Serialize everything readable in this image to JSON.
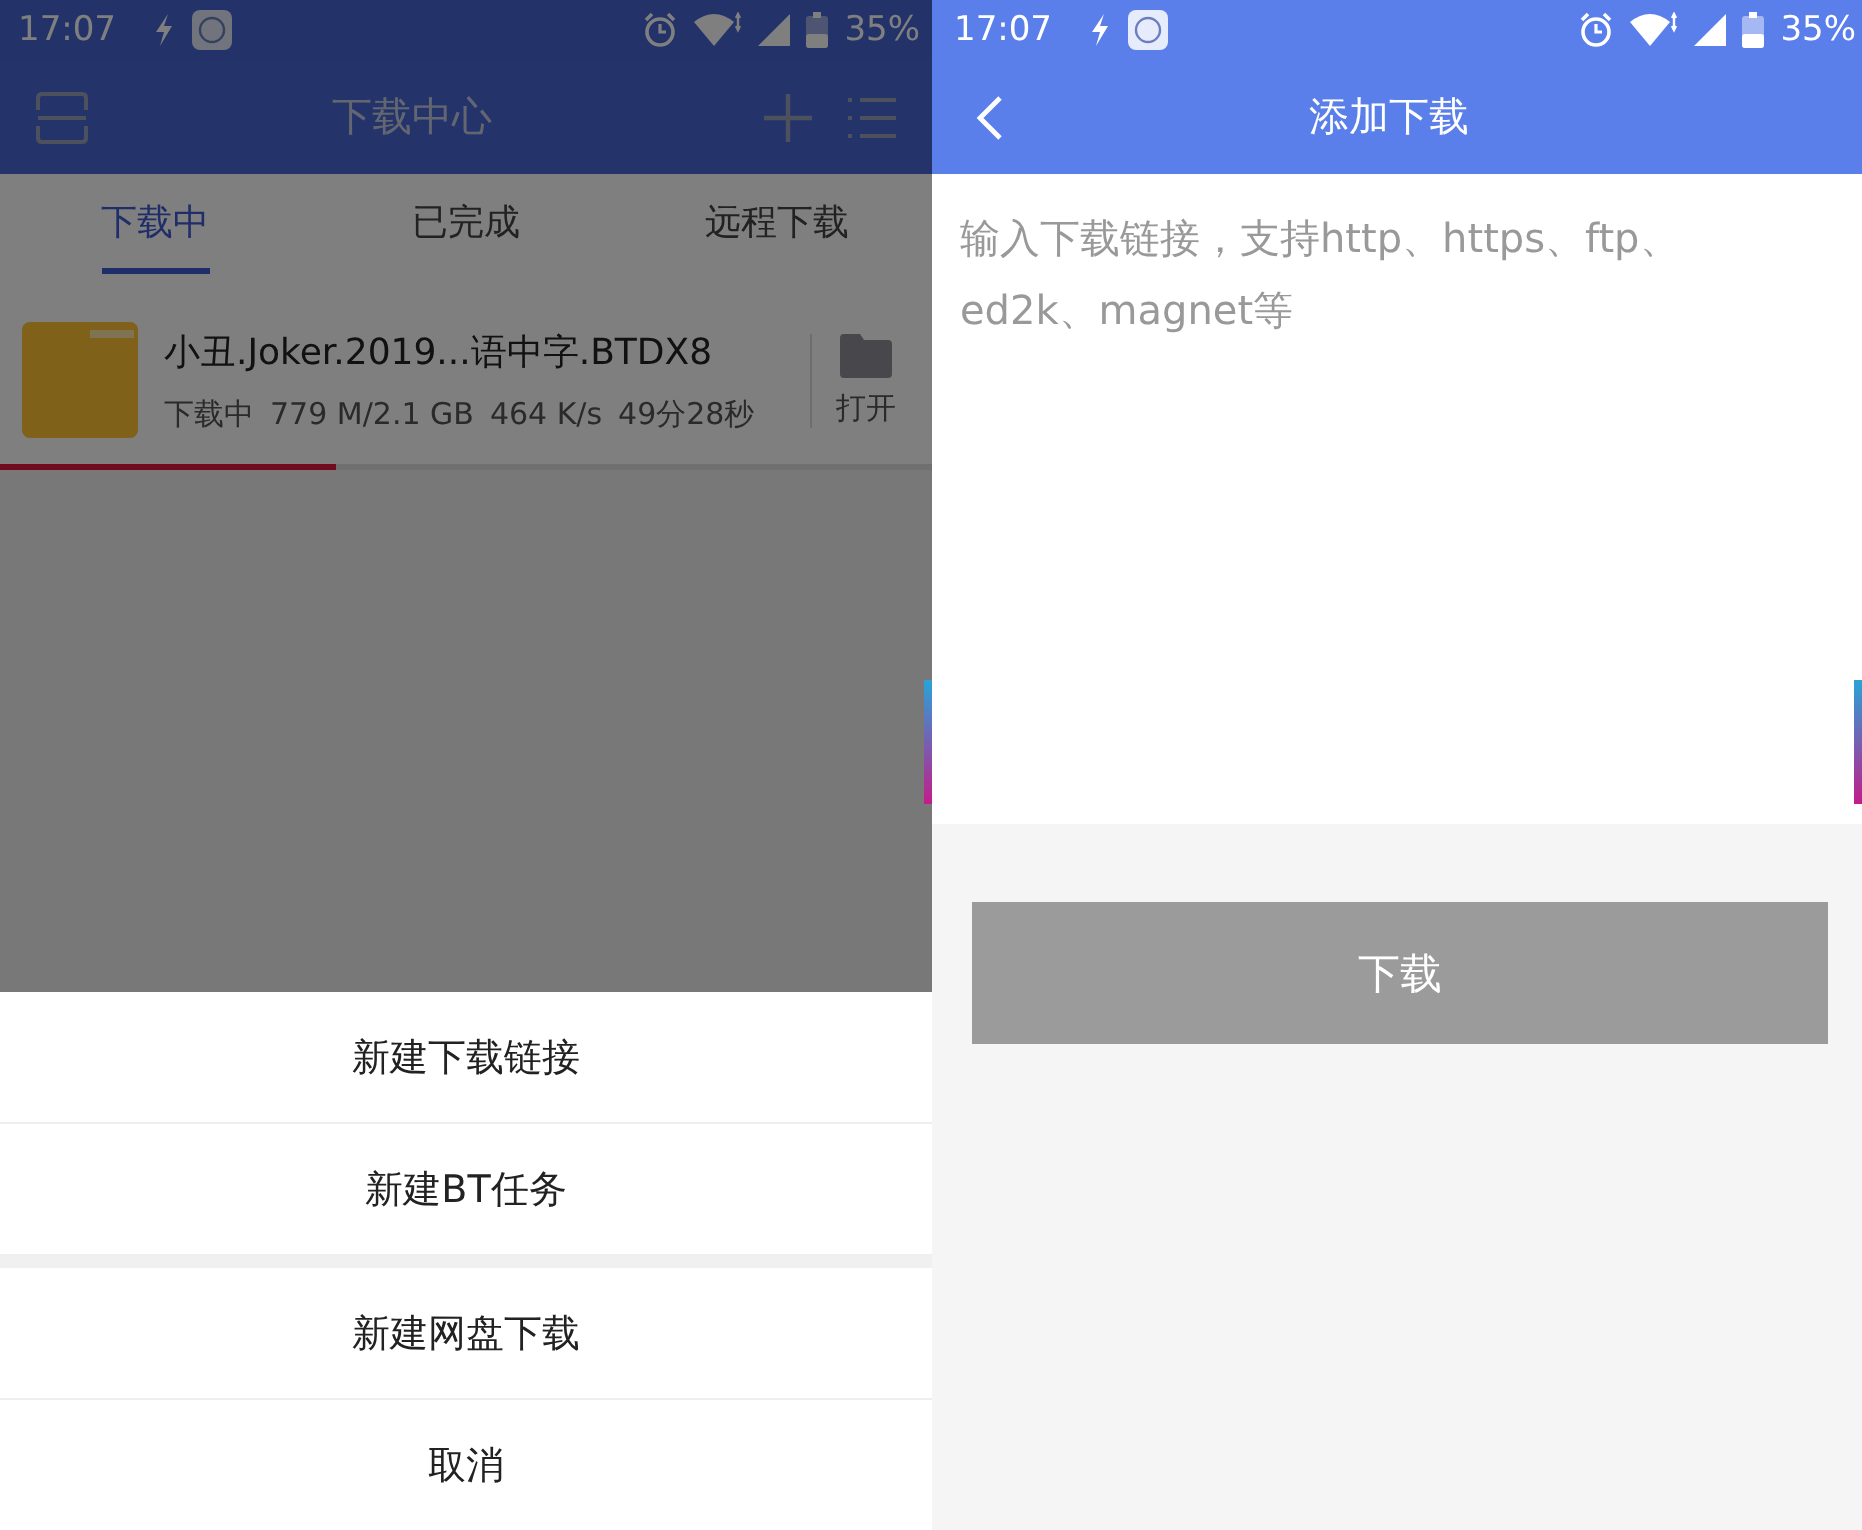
{
  "left_screen": {
    "status_bar": {
      "time": "17:07",
      "battery": "35%"
    },
    "app_bar": {
      "title": "下载中心"
    },
    "tabs": [
      {
        "label": "下载中",
        "selected": true
      },
      {
        "label": "已完成",
        "selected": false
      },
      {
        "label": "远程下载",
        "selected": false
      }
    ],
    "downloads": [
      {
        "name": "小丑.Joker.2019...语中字.BTDX8",
        "status": "下载中",
        "size": "779 M/2.1 GB",
        "speed": "464 K/s",
        "remaining": "49分28秒",
        "action": "打开",
        "level": 0.36
      }
    ],
    "dimmed": true,
    "action_sheet": {
      "groups": [
        {
          "items": [
            "新建下载链接",
            "新建BT任务"
          ]
        },
        {
          "items": [
            "新建网盘下载",
            "取消"
          ]
        }
      ]
    }
  },
  "right_screen": {
    "status_bar": {
      "time": "17:07",
      "battery": "35%"
    },
    "app_bar": {
      "title": "添加下载"
    },
    "link_field": {
      "placeholder": "输入下载链接，支持http、https、ftp、ed2k、magnet等"
    },
    "download_button": "下载"
  }
}
